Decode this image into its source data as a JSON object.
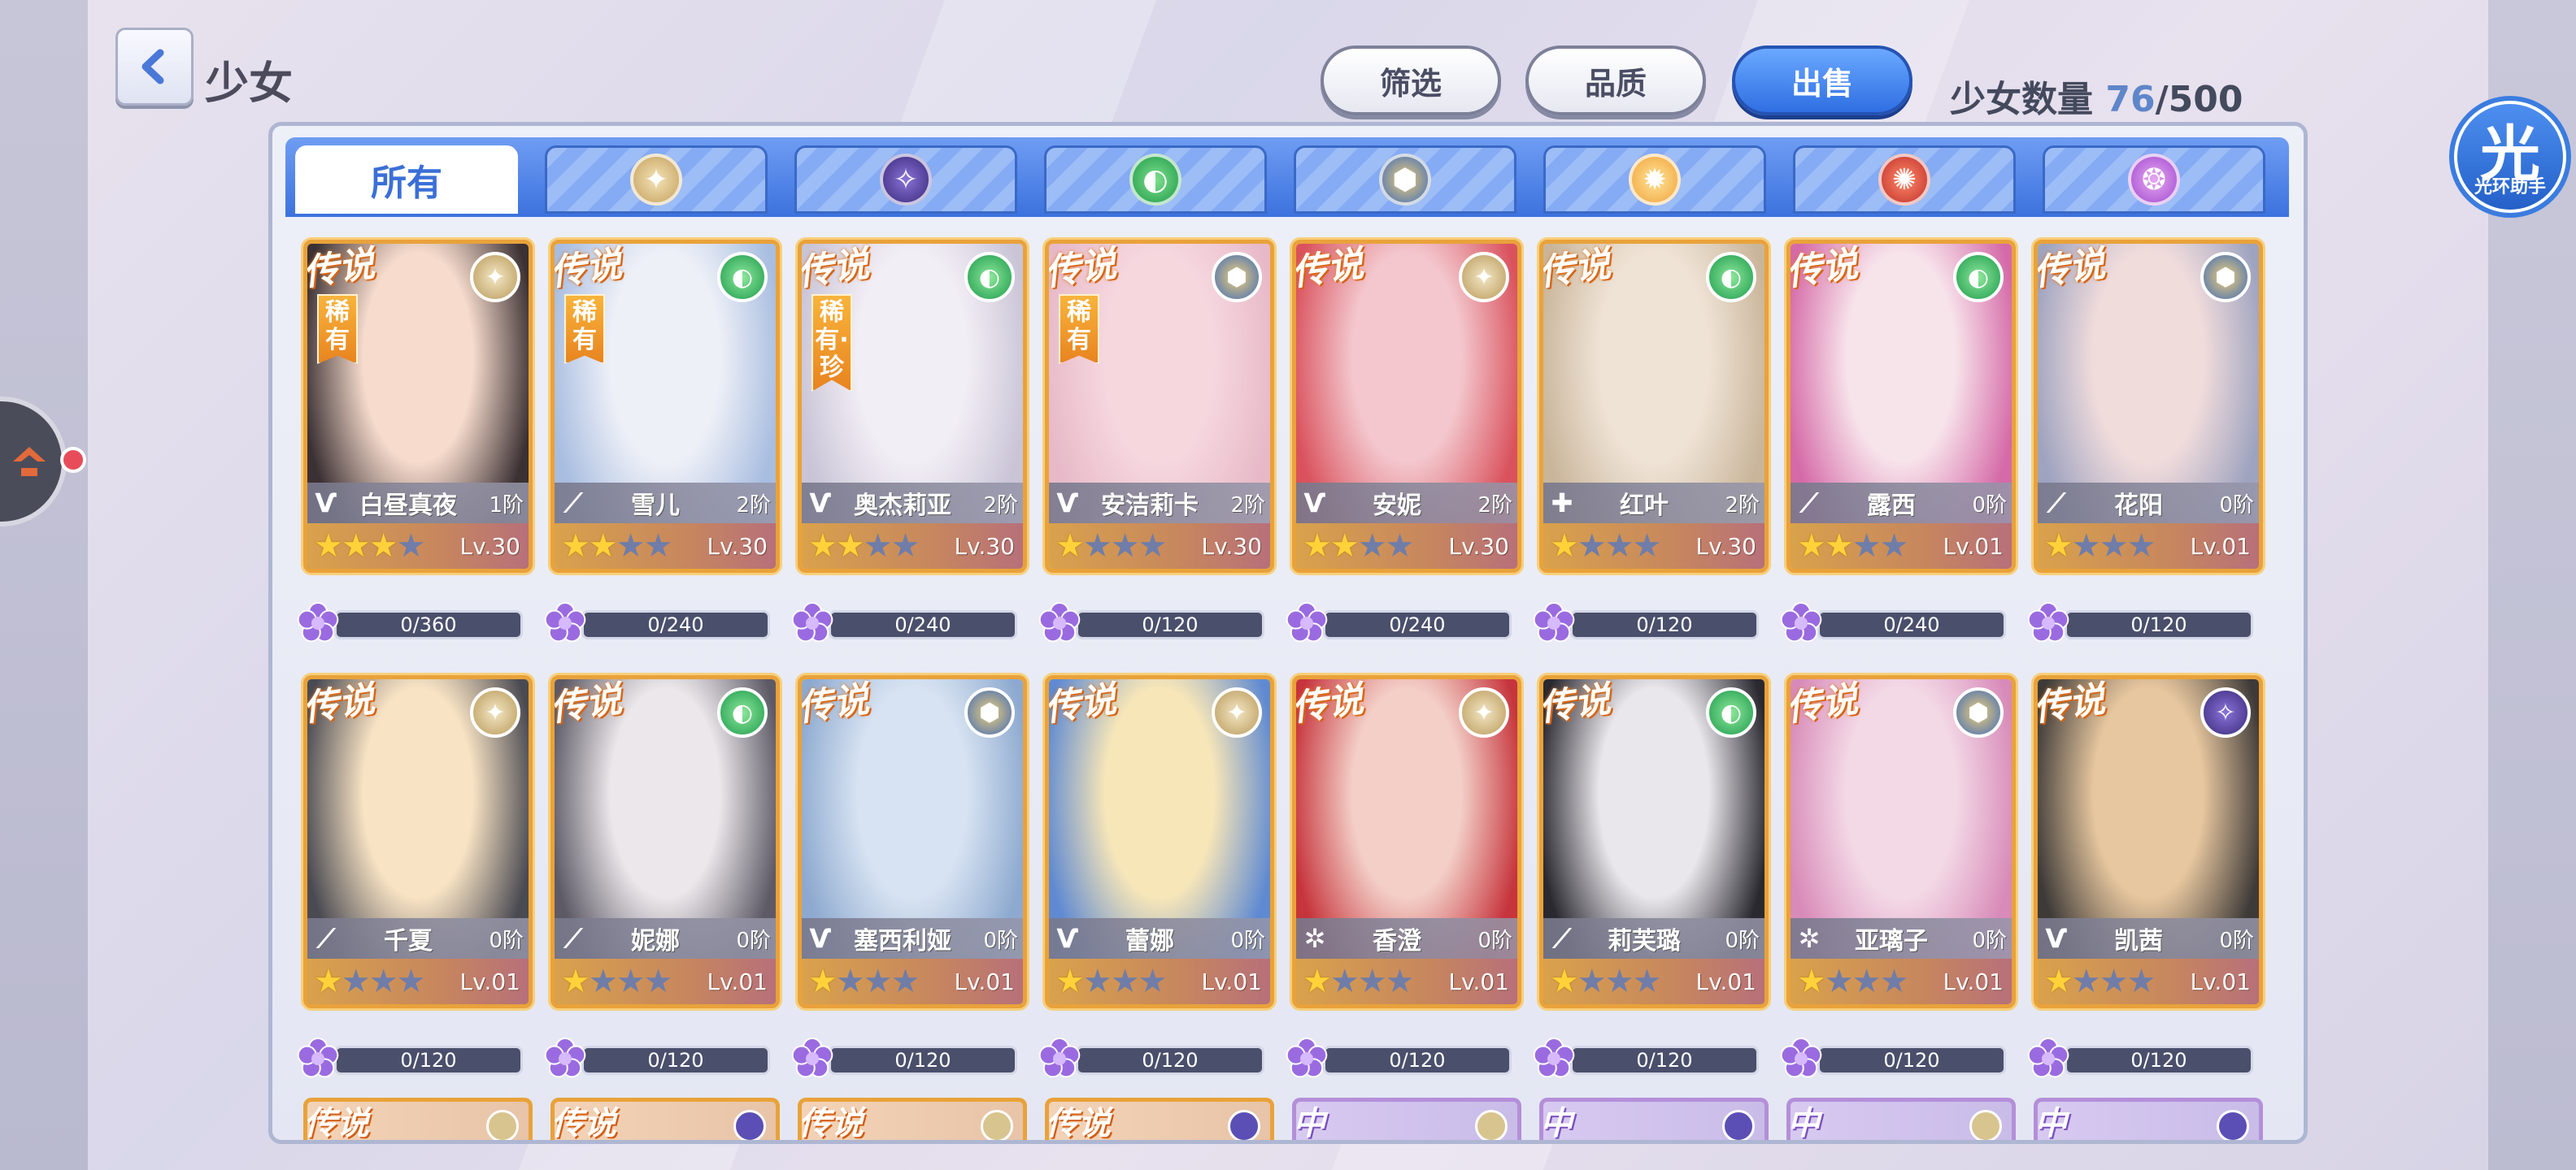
{
  "header": {
    "title": "少女",
    "buttons": {
      "filter": "筛选",
      "quality": "品质",
      "sell": "出售"
    },
    "count_label": "少女数量",
    "count_current": "76",
    "count_sep": "/",
    "count_max": "500"
  },
  "helper": {
    "glyph": "光",
    "label": "光环助手"
  },
  "tabs": {
    "all": "所有"
  },
  "colors": {
    "accent_blue": "#3b6fd6",
    "legend_orange": "#e9a23a",
    "star_gold": "#ffd23a",
    "notification_red": "#e84c5b"
  },
  "characters": [
    {
      "name": "白昼真夜",
      "rank": "1阶",
      "level": "Lv.30",
      "stars": 3,
      "exp": "0/360",
      "rarity_tag": "稀有",
      "element": "light-icon",
      "class": "wing-icon"
    },
    {
      "name": "雪儿",
      "rank": "2阶",
      "level": "Lv.30",
      "stars": 2,
      "exp": "0/240",
      "rarity_tag": "稀有",
      "element": "wind-icon",
      "class": "feather-icon"
    },
    {
      "name": "奥杰莉亚",
      "rank": "2阶",
      "level": "Lv.30",
      "stars": 2,
      "exp": "0/240",
      "rarity_tag": "稀有·珍",
      "element": "wind-icon",
      "class": "wing-icon"
    },
    {
      "name": "安洁莉卡",
      "rank": "2阶",
      "level": "Lv.30",
      "stars": 1,
      "exp": "0/120",
      "rarity_tag": "稀有",
      "element": "earth-icon",
      "class": "wing-icon"
    },
    {
      "name": "安妮",
      "rank": "2阶",
      "level": "Lv.30",
      "stars": 2,
      "exp": "0/240",
      "rarity_tag": "",
      "element": "light-icon",
      "class": "wing-icon"
    },
    {
      "name": "红叶",
      "rank": "2阶",
      "level": "Lv.30",
      "stars": 1,
      "exp": "0/120",
      "rarity_tag": "",
      "element": "wind-icon",
      "class": "cross-icon"
    },
    {
      "name": "露西",
      "rank": "0阶",
      "level": "Lv.01",
      "stars": 2,
      "exp": "0/240",
      "rarity_tag": "",
      "element": "wind-icon",
      "class": "feather-icon"
    },
    {
      "name": "花阳",
      "rank": "0阶",
      "level": "Lv.01",
      "stars": 1,
      "exp": "0/120",
      "rarity_tag": "",
      "element": "earth-icon",
      "class": "feather-icon"
    },
    {
      "name": "千夏",
      "rank": "0阶",
      "level": "Lv.01",
      "stars": 1,
      "exp": "0/120",
      "rarity_tag": "",
      "element": "light-icon",
      "class": "feather-icon"
    },
    {
      "name": "妮娜",
      "rank": "0阶",
      "level": "Lv.01",
      "stars": 1,
      "exp": "0/120",
      "rarity_tag": "",
      "element": "wind-icon",
      "class": "feather-icon"
    },
    {
      "name": "塞西利娅",
      "rank": "0阶",
      "level": "Lv.01",
      "stars": 1,
      "exp": "0/120",
      "rarity_tag": "",
      "element": "earth-icon",
      "class": "wing-icon"
    },
    {
      "name": "蕾娜",
      "rank": "0阶",
      "level": "Lv.01",
      "stars": 1,
      "exp": "0/120",
      "rarity_tag": "",
      "element": "light-icon",
      "class": "wing-icon"
    },
    {
      "name": "香澄",
      "rank": "0阶",
      "level": "Lv.01",
      "stars": 1,
      "exp": "0/120",
      "rarity_tag": "",
      "element": "light-icon",
      "class": "sparkle-icon"
    },
    {
      "name": "莉芙璐",
      "rank": "0阶",
      "level": "Lv.01",
      "stars": 1,
      "exp": "0/120",
      "rarity_tag": "",
      "element": "wind-icon",
      "class": "feather-icon"
    },
    {
      "name": "亚璃子",
      "rank": "0阶",
      "level": "Lv.01",
      "stars": 1,
      "exp": "0/120",
      "rarity_tag": "",
      "element": "earth-icon",
      "class": "sparkle-icon"
    },
    {
      "name": "凯茜",
      "rank": "0阶",
      "level": "Lv.01",
      "stars": 1,
      "exp": "0/120",
      "rarity_tag": "",
      "element": "dark-icon",
      "class": "wing-icon"
    }
  ],
  "card_mark": {
    "legend": "传说",
    "mid": "中"
  },
  "partial_row": [
    "legend",
    "legend",
    "legend",
    "legend",
    "mid",
    "mid",
    "mid",
    "mid"
  ]
}
